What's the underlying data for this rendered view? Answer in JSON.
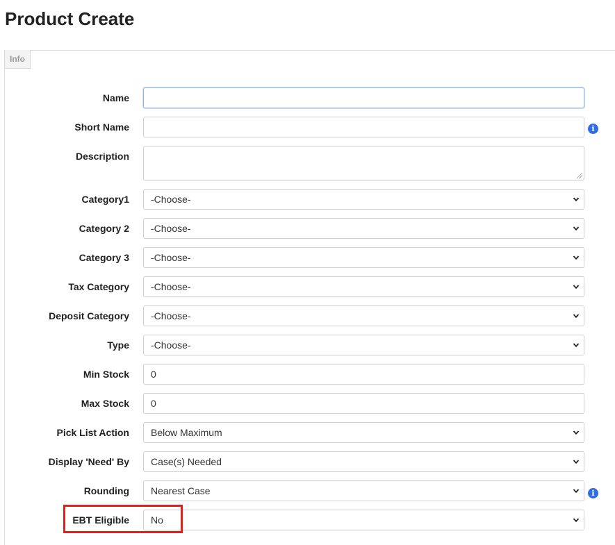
{
  "page": {
    "title": "Product Create"
  },
  "tabs": [
    {
      "label": "Info",
      "active": true
    }
  ],
  "form": {
    "name": {
      "label": "Name",
      "value": ""
    },
    "short_name": {
      "label": "Short Name",
      "value": ""
    },
    "description": {
      "label": "Description",
      "value": ""
    },
    "category1": {
      "label": "Category1",
      "value": "-Choose-"
    },
    "category2": {
      "label": "Category 2",
      "value": "-Choose-"
    },
    "category3": {
      "label": "Category 3",
      "value": "-Choose-"
    },
    "tax_category": {
      "label": "Tax Category",
      "value": "-Choose-"
    },
    "deposit_category": {
      "label": "Deposit Category",
      "value": "-Choose-"
    },
    "type": {
      "label": "Type",
      "value": "-Choose-"
    },
    "min_stock": {
      "label": "Min Stock",
      "value": "0"
    },
    "max_stock": {
      "label": "Max Stock",
      "value": "0"
    },
    "pick_list_action": {
      "label": "Pick List Action",
      "value": "Below Maximum"
    },
    "display_need_by": {
      "label": "Display 'Need' By",
      "value": "Case(s) Needed"
    },
    "rounding": {
      "label": "Rounding",
      "value": "Nearest Case"
    },
    "ebt_eligible": {
      "label": "EBT Eligible",
      "value": "No"
    }
  },
  "icons": {
    "info": "info-icon",
    "dropdown": "chevron-down-icon"
  },
  "colors": {
    "highlight": "#e0201c",
    "info_icon": "#2f6de1",
    "focus_border": "#8db6e6"
  }
}
